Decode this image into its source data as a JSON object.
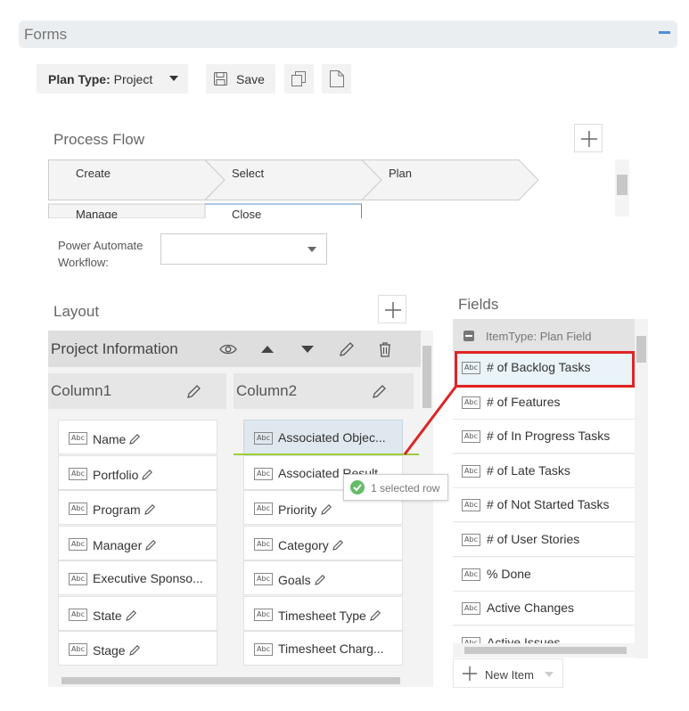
{
  "header": {
    "title": "Forms"
  },
  "toolbar": {
    "plan_type_label": "Plan Type:",
    "plan_type_value": "Project",
    "save_label": "Save"
  },
  "process_flow": {
    "title": "Process Flow",
    "stages": [
      "Create",
      "Select",
      "Plan",
      "Manage",
      "Close"
    ]
  },
  "power_automate": {
    "label_line1": "Power Automate",
    "label_line2": "Workflow:",
    "value": ""
  },
  "layout": {
    "title": "Layout",
    "section_name": "Project Information",
    "column1": {
      "name": "Column1",
      "fields": [
        "Name",
        "Portfolio",
        "Program",
        "Manager",
        "Executive Sponso...",
        "State",
        "Stage"
      ]
    },
    "column2": {
      "name": "Column2",
      "fields": [
        "Associated Objec...",
        "Associated Result",
        "Priority",
        "Category",
        "Goals",
        "Timesheet Type",
        "Timesheet Charg..."
      ]
    },
    "tooltip": "1 selected row"
  },
  "fields": {
    "title": "Fields",
    "group_label": "ItemType: Plan Field",
    "items": [
      "# of Backlog Tasks",
      "# of Features",
      "# of In Progress Tasks",
      "# of Late Tasks",
      "# of Not Started Tasks",
      "# of User Stories",
      "% Done",
      "Active Changes",
      "Active Issues"
    ],
    "new_item_label": "New Item"
  },
  "abc_glyph": "Abc",
  "colors": {
    "highlight": "#e02424",
    "drop_line": "#9ccc3c",
    "accent": "#4a90d9"
  }
}
